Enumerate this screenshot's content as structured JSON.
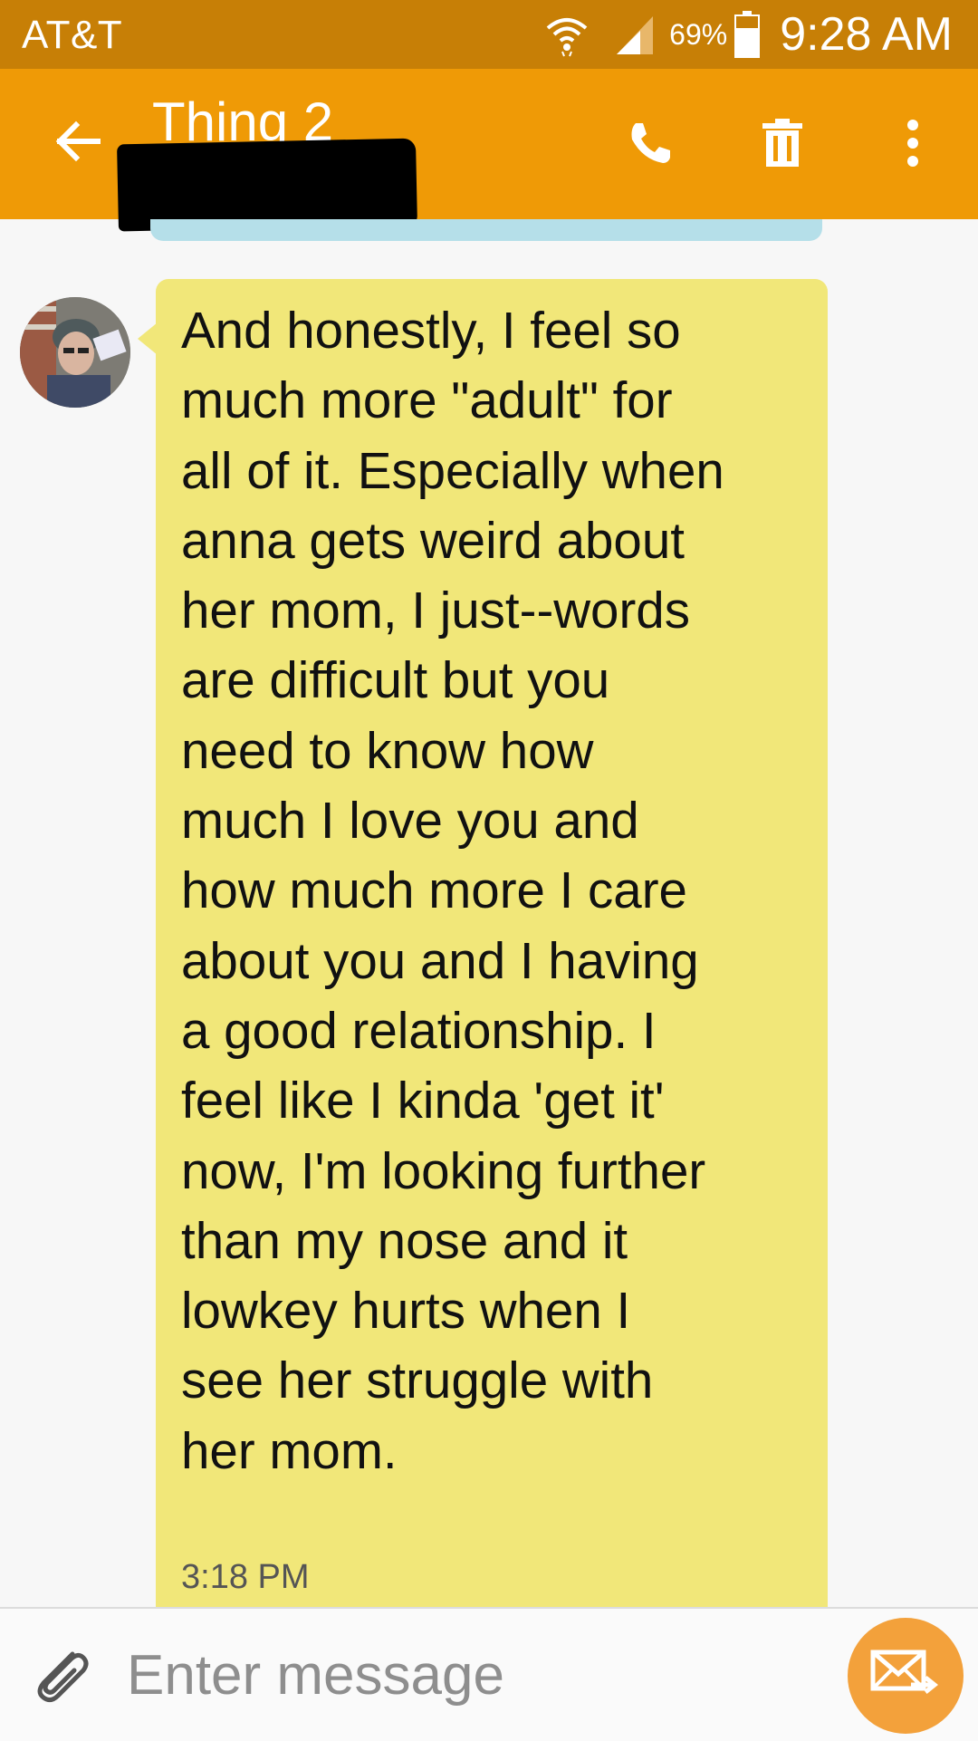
{
  "status_bar": {
    "carrier": "AT&T",
    "battery_percent": "69%",
    "time": "9:28 AM",
    "icons": [
      "wifi-icon",
      "signal-icon",
      "battery-icon"
    ]
  },
  "app_bar": {
    "contact_name": "Thing 2",
    "icons": [
      "back-arrow-icon",
      "phone-icon",
      "trash-icon",
      "more-vert-icon"
    ]
  },
  "conversation": {
    "messages": [
      {
        "direction": "incoming",
        "text": "And honestly, I feel so\nmuch more \"adult\" for\nall of it. Especially when\nanna gets weird about\nher mom, I just--words\nare difficult but you\nneed to know how\nmuch I love you and\nhow much more I care\nabout you and I having\na good relationship. I\nfeel like I kinda 'get it'\nnow, I'm looking further\nthan my nose and it\nlowkey hurts when I\nsee her struggle with\nher mom.",
        "time": "3:18 PM"
      }
    ]
  },
  "composer": {
    "placeholder": "Enter message",
    "icons": [
      "paperclip-icon",
      "send-message-icon"
    ]
  },
  "colors": {
    "status_bar": "#c77f06",
    "app_bar": "#ef9a06",
    "incoming_bubble": "#f1e779",
    "outgoing_bubble": "#b5dfe9",
    "send_button": "#f3a13b"
  }
}
